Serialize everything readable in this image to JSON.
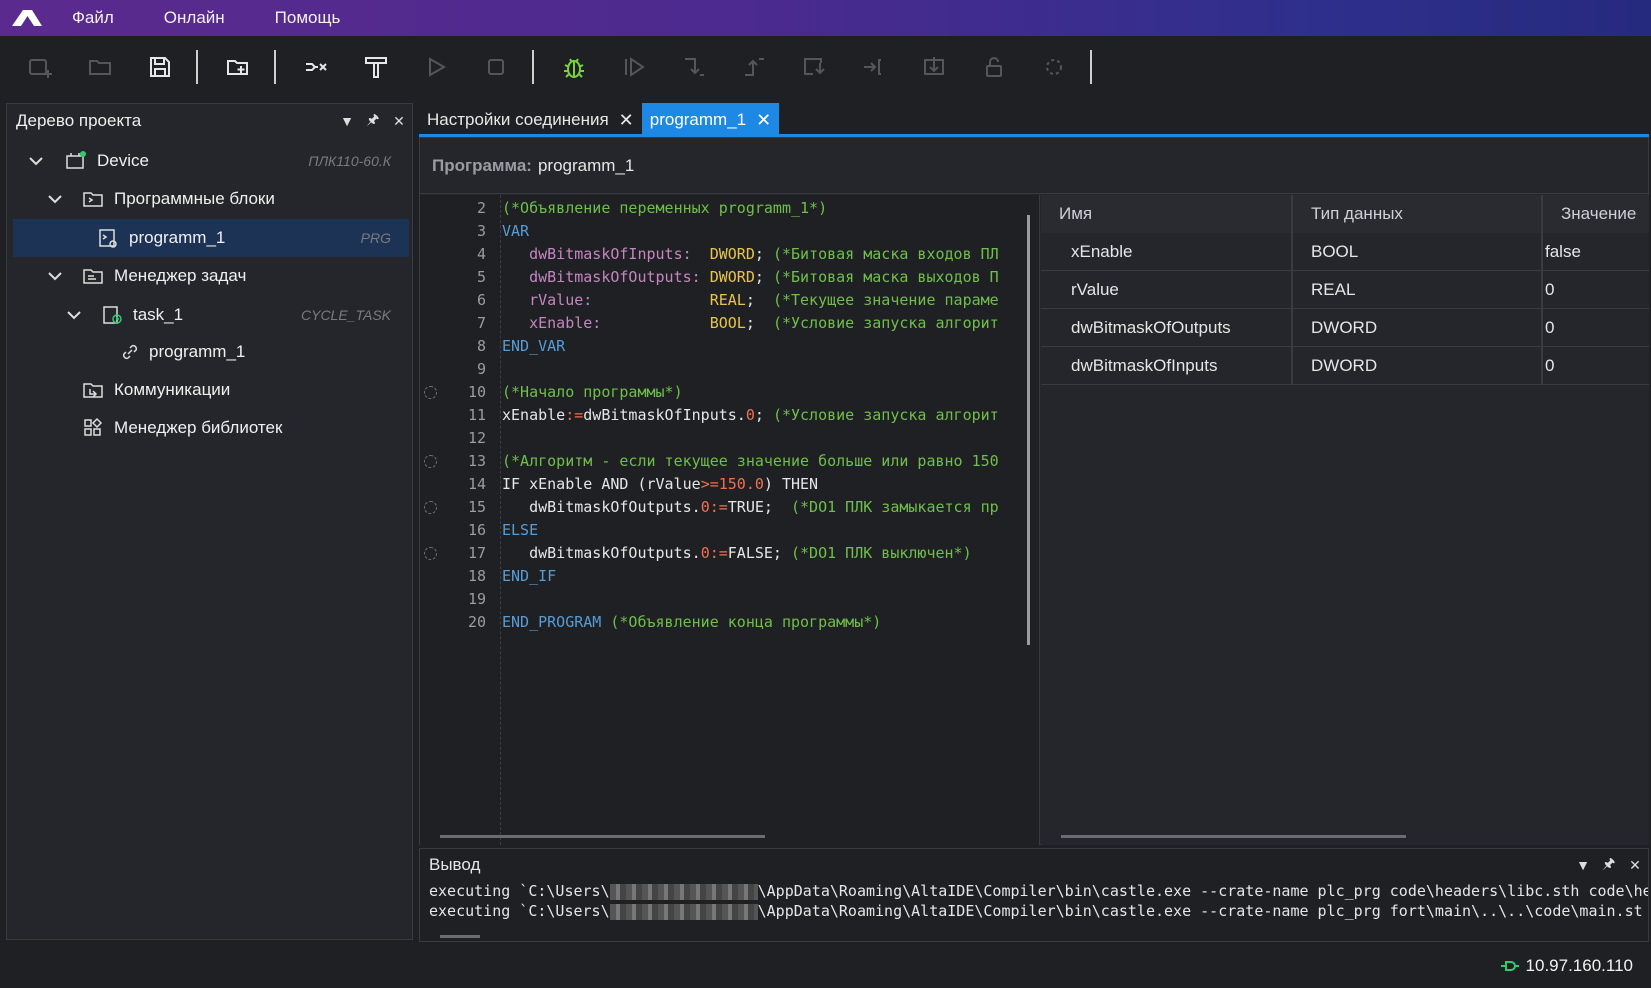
{
  "menu": [
    "Файл",
    "Онлайн",
    "Помощь"
  ],
  "tree": {
    "title": "Дерево проекта",
    "items": [
      {
        "label": "Device",
        "tag": "ПЛК110-60.К"
      },
      {
        "label": "Программные блоки",
        "tag": ""
      },
      {
        "label": "programm_1",
        "tag": "PRG"
      },
      {
        "label": "Менеджер задач",
        "tag": ""
      },
      {
        "label": "task_1",
        "tag": "CYCLE_TASK"
      },
      {
        "label": "programm_1",
        "tag": ""
      },
      {
        "label": "Коммуникации",
        "tag": ""
      },
      {
        "label": "Менеджер библиотек",
        "tag": ""
      }
    ]
  },
  "tabs": [
    {
      "label": "Настройки соединения",
      "close": "✕"
    },
    {
      "label": "programm_1",
      "close": "✕"
    }
  ],
  "program": {
    "label": "Программа:",
    "name": "programm_1"
  },
  "code": {
    "line_numbers": [
      "2",
      "3",
      "4",
      "5",
      "6",
      "7",
      "8",
      "9",
      "10",
      "11",
      "12",
      "13",
      "14",
      "15",
      "16",
      "17",
      "18",
      "19",
      "20"
    ]
  },
  "variables": {
    "headers": [
      "Имя",
      "Тип данных",
      "Значение"
    ],
    "rows": [
      {
        "name": "xEnable",
        "type": "BOOL",
        "value": "false"
      },
      {
        "name": "rValue",
        "type": "REAL",
        "value": "0"
      },
      {
        "name": "dwBitmaskOfOutputs",
        "type": "DWORD",
        "value": "0"
      },
      {
        "name": "dwBitmaskOfInputs",
        "type": "DWORD",
        "value": "0"
      }
    ]
  },
  "output": {
    "title": "Вывод",
    "lines": [
      {
        "prefix": "executing `C:\\Users\\",
        "suffix": "\\AppData\\Roaming\\AltaIDE\\Compiler\\bin\\castle.exe --crate-name plc_prg code\\headers\\libc.sth code\\hea"
      },
      {
        "prefix": "executing `C:\\Users\\",
        "suffix": "\\AppData\\Roaming\\AltaIDE\\Compiler\\bin\\castle.exe --crate-name plc_prg fort\\main\\..\\..\\code\\main.st -"
      }
    ]
  },
  "status": {
    "ip": "10.97.160.110",
    "color": "#2ecc71"
  }
}
